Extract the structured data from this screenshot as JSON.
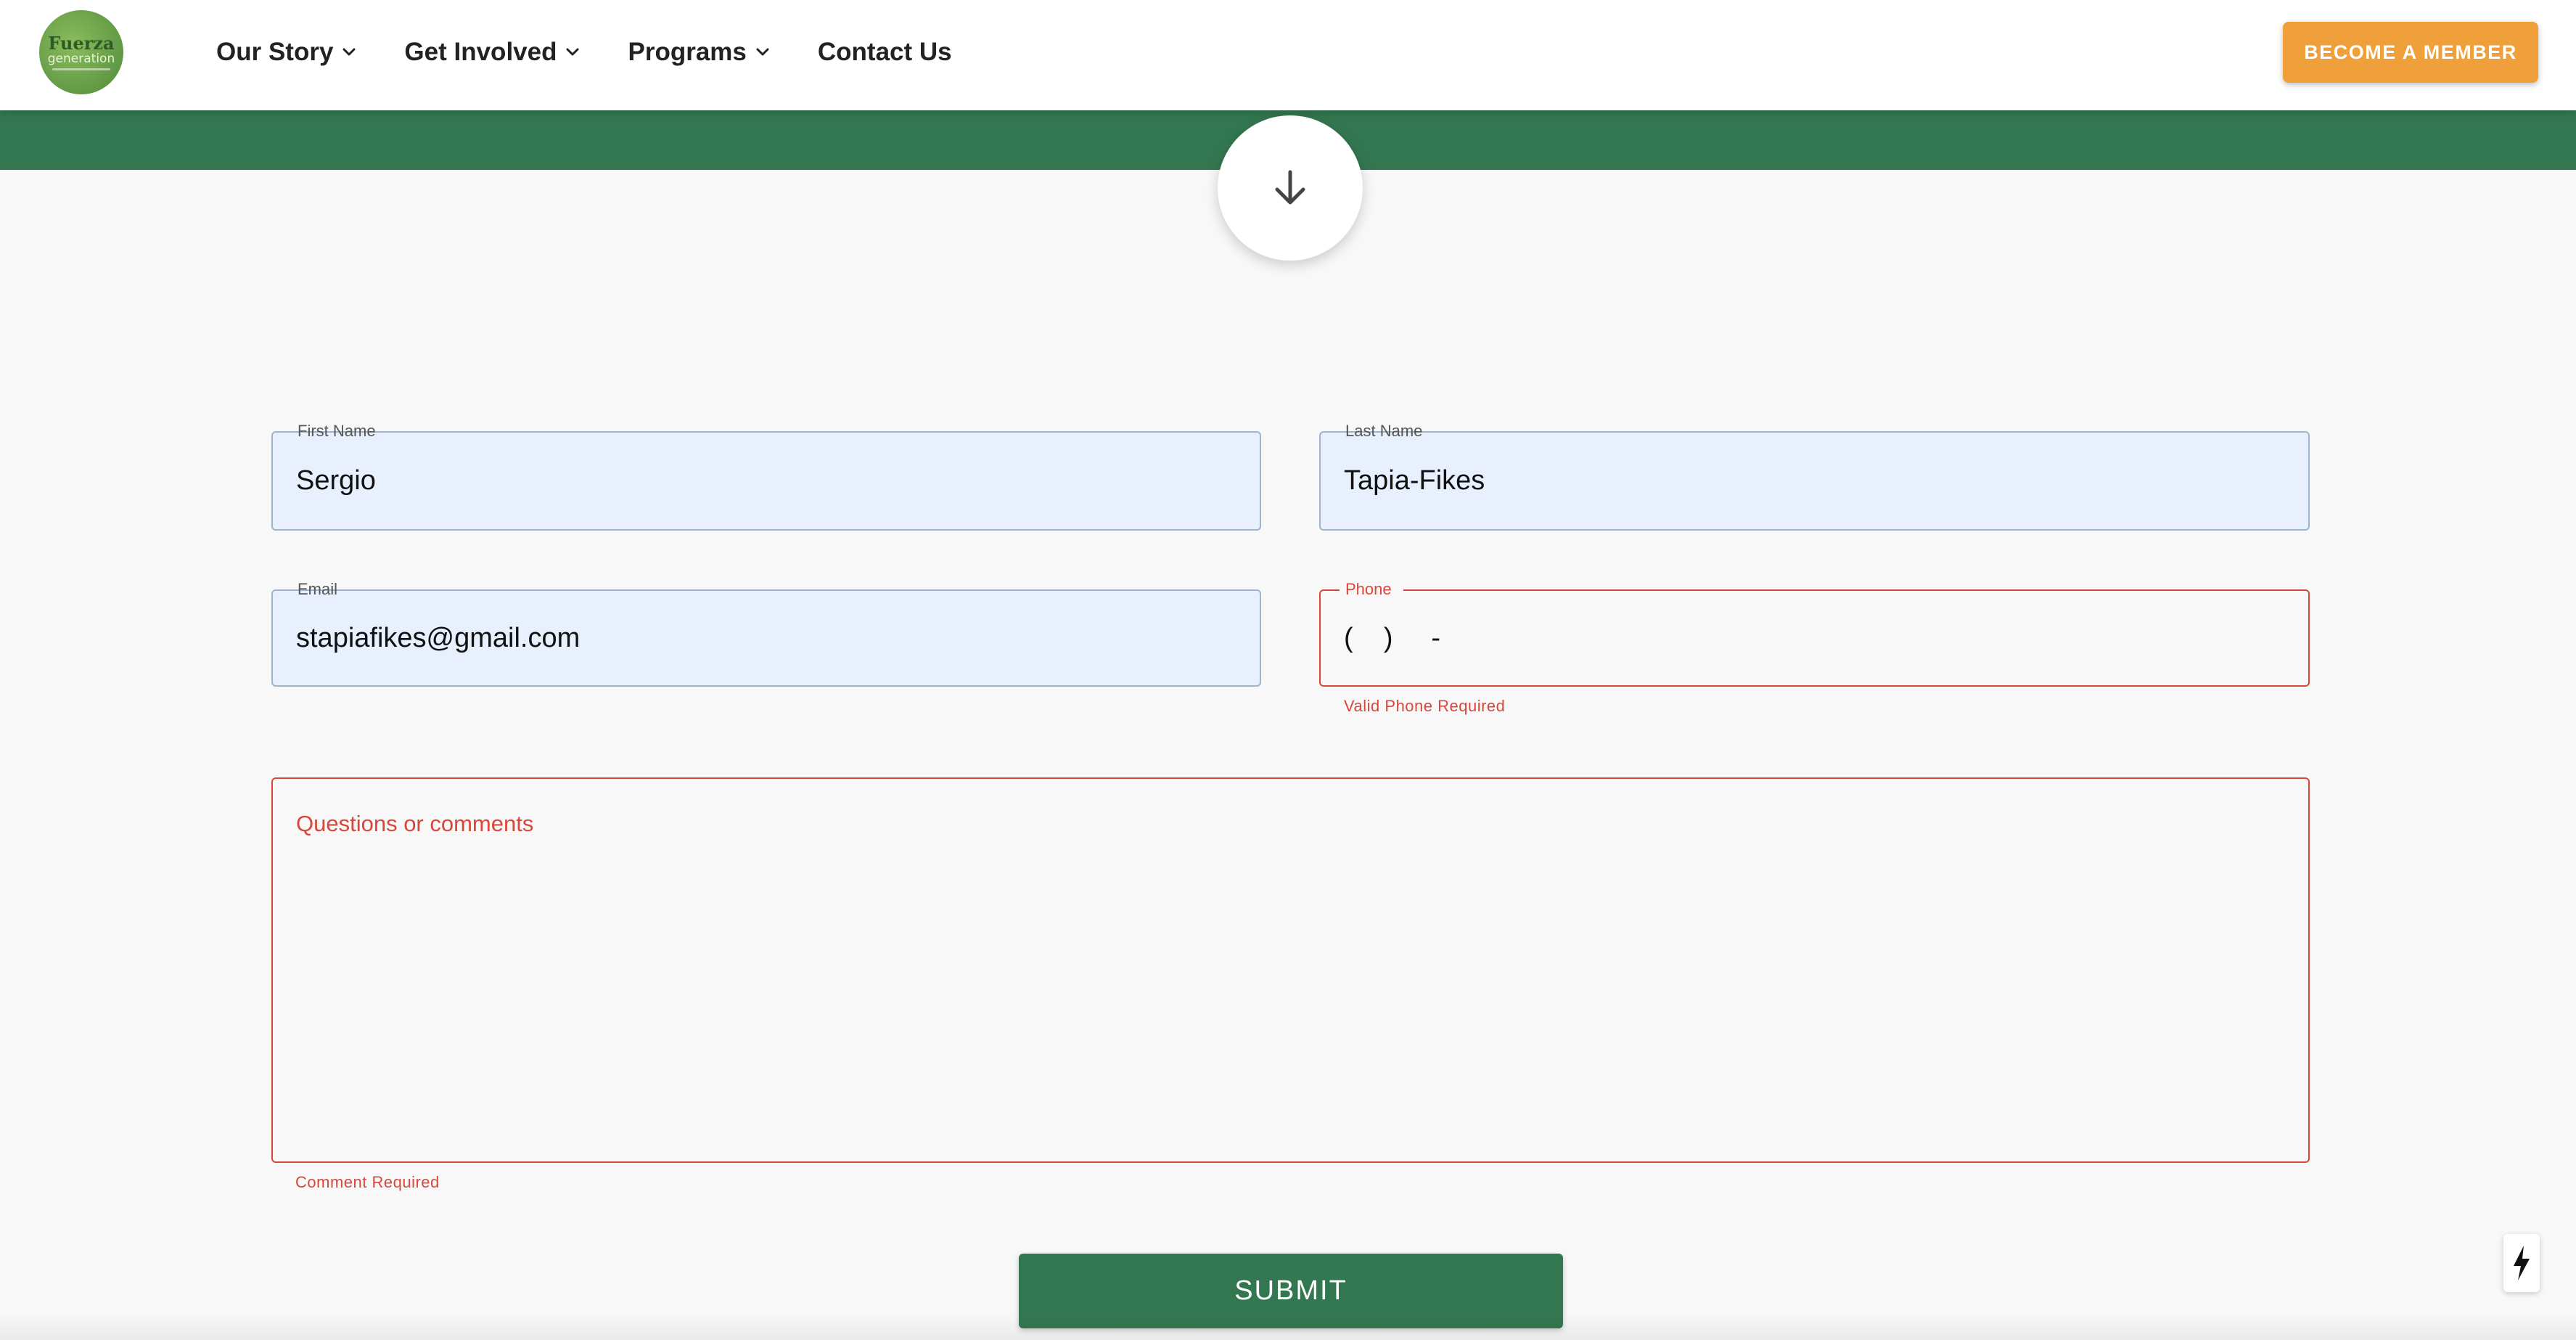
{
  "header": {
    "logo": {
      "line1": "Fuerza",
      "line2": "generation"
    },
    "nav": [
      {
        "label": "Our Story",
        "has_dropdown": true
      },
      {
        "label": "Get Involved",
        "has_dropdown": true
      },
      {
        "label": "Programs",
        "has_dropdown": true
      },
      {
        "label": "Contact Us",
        "has_dropdown": false
      }
    ],
    "member_button": "BECOME A MEMBER"
  },
  "hero": {
    "icon": "arrow-down-icon"
  },
  "form": {
    "first_name": {
      "label": "First Name",
      "value": "Sergio"
    },
    "last_name": {
      "label": "Last Name",
      "value": "Tapia-Fikes"
    },
    "email": {
      "label": "Email",
      "value": "stapiafikes@gmail.com"
    },
    "phone": {
      "label": "Phone",
      "value": "(    )     -",
      "error": "Valid Phone Required"
    },
    "comments": {
      "placeholder": "Questions or comments",
      "error": "Comment Required"
    },
    "submit_label": "SUBMIT"
  },
  "floating": {
    "icon": "lightning-bolt-icon"
  },
  "colors": {
    "brand_green": "#337750",
    "accent_orange": "#f0a03b",
    "error_red": "#d9473b",
    "autofill_blue": "#e8f0fd"
  }
}
